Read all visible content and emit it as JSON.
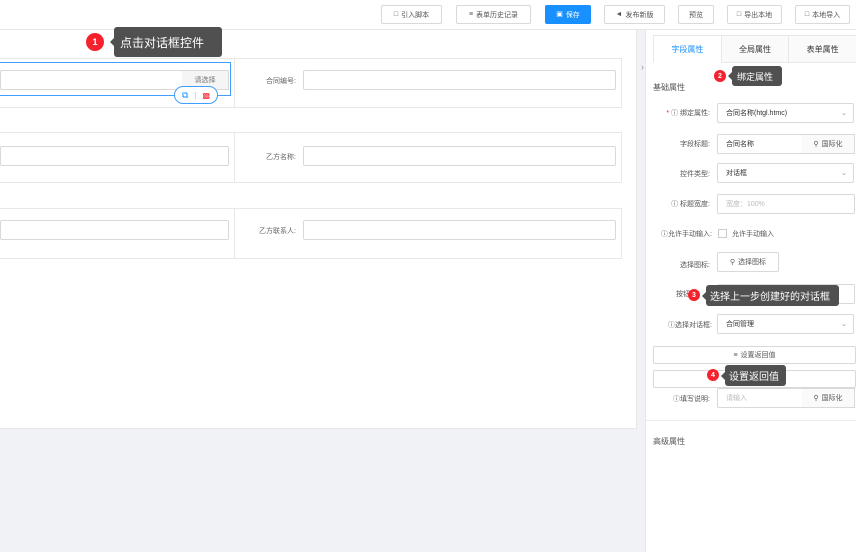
{
  "toolbar": {
    "import_script": "引入脚本",
    "form_history": "表单历史记录",
    "save": "保存",
    "publish": "发布新版",
    "preview": "预览",
    "export_local": "导出本地",
    "import_local": "本地导入"
  },
  "form": {
    "select_button": "请选择",
    "contract_no_label": "合同编号:",
    "party_b_name_label": "乙方名称:",
    "party_b_contact_label": "乙方联系人:"
  },
  "panel": {
    "tabs": [
      "字段属性",
      "全局属性",
      "表单属性"
    ],
    "basic_section": "基础属性",
    "advanced_section": "高级属性",
    "bind_attr_label": "绑定属性:",
    "bind_attr_value": "合同名称(htgl.htmc)",
    "field_title_label": "字段标题:",
    "field_title_value": "合同名称",
    "i18n": "国际化",
    "control_type_label": "控件类型:",
    "control_type_value": "对话框",
    "title_width_label": "标题宽度:",
    "title_width_placeholder": "宽度：100%",
    "allow_manual_label": "允许手动输入:",
    "allow_manual_text": "允许手动输入",
    "select_icon_label": "选择图标:",
    "select_icon_button": "选择图标",
    "button_text_label": "按钮",
    "select_dialog_label": "选择对话框:",
    "select_dialog_value": "合同管理",
    "set_return_button": "设置返回值",
    "fill_desc_label": "填写说明:",
    "fill_desc_placeholder": "请输入"
  },
  "annotations": {
    "step1": {
      "num": "1",
      "text": "点击对话框控件"
    },
    "step2": {
      "num": "2",
      "text": "绑定属性"
    },
    "step3": {
      "num": "3",
      "text": "选择上一步创建好的对话框"
    },
    "step4": {
      "num": "4",
      "text": "设置返回值"
    }
  },
  "colors": {
    "primary": "#1890ff",
    "badge": "#f5222d",
    "tooltip": "#505050"
  }
}
